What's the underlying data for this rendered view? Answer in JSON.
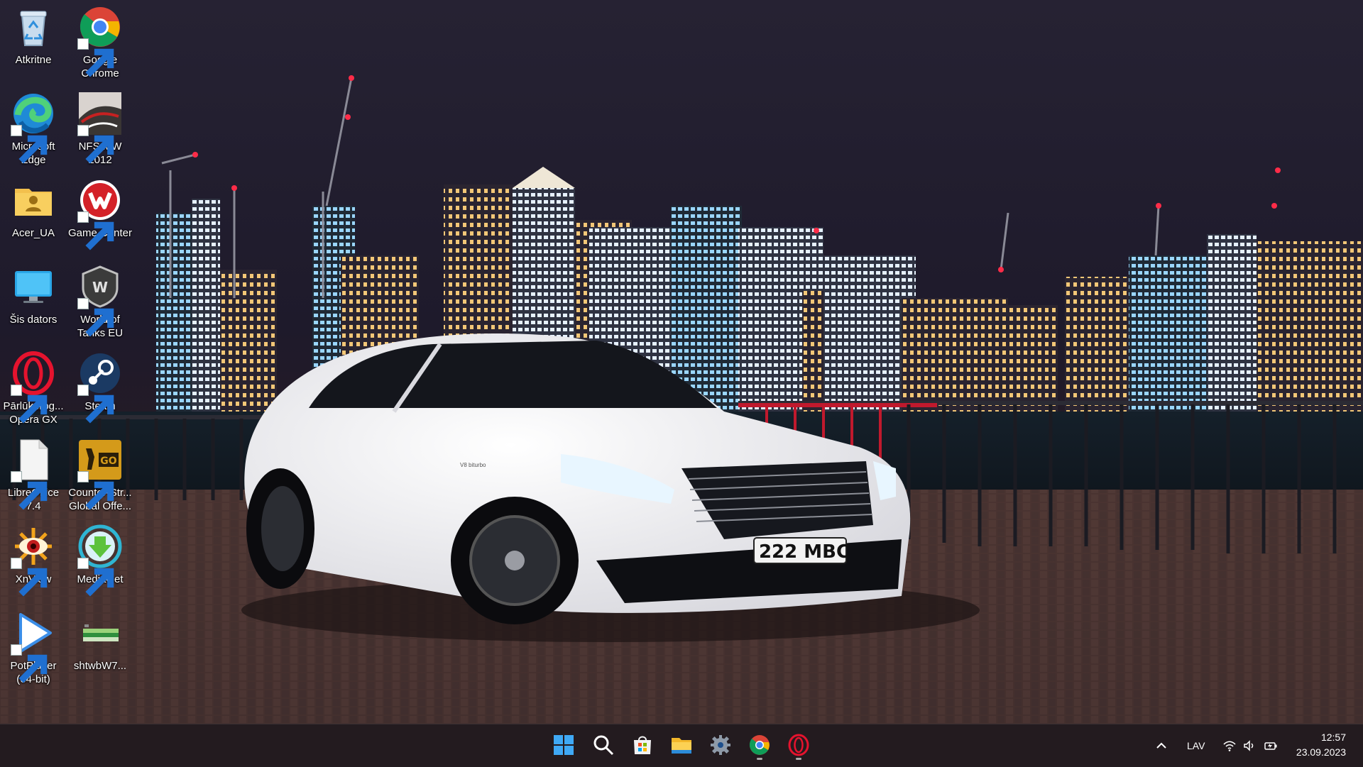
{
  "desktop": {
    "icons": [
      {
        "label": "Atkritne",
        "icon": "recycle-bin-icon"
      },
      {
        "label": "Google Chrome",
        "icon": "chrome-icon"
      },
      {
        "label": "Microsoft Edge",
        "icon": "edge-icon"
      },
      {
        "label": "NFS MW 2012",
        "icon": "nfs-game-icon"
      },
      {
        "label": "Acer_UA",
        "icon": "user-folder-icon"
      },
      {
        "label": "Game Center",
        "icon": "game-center-icon"
      },
      {
        "label": "Šis dators",
        "icon": "this-pc-icon"
      },
      {
        "label": "World of Tanks EU",
        "icon": "world-of-tanks-icon"
      },
      {
        "label": "Pārlūkprog... Opera GX",
        "icon": "opera-gx-icon"
      },
      {
        "label": "Steam",
        "icon": "steam-icon"
      },
      {
        "label": "LibreOffice 7.4",
        "icon": "libreoffice-icon"
      },
      {
        "label": "Counter-Str... Global Offe...",
        "icon": "csgo-icon"
      },
      {
        "label": "XnView",
        "icon": "xnview-icon"
      },
      {
        "label": "MediaGet",
        "icon": "mediaget-icon"
      },
      {
        "label": "PotPlayer (64-bit)",
        "icon": "potplayer-icon"
      },
      {
        "label": "shtwbW7...",
        "icon": "file-icon"
      }
    ]
  },
  "wallpaper": {
    "plate": "222 MBC",
    "badge": "V8 biturbo"
  },
  "taskbar": {
    "apps": [
      "start-icon",
      "search-icon",
      "microsoft-store-icon",
      "file-explorer-icon",
      "settings-icon",
      "chrome-icon",
      "opera-gx-icon"
    ],
    "language": "LAV",
    "time": "12:57",
    "date": "23.09.2023"
  },
  "colors": {
    "taskbar_bg": "#231b1f",
    "accent_blue": "#4fa3f7",
    "opera_red": "#e5132e"
  }
}
